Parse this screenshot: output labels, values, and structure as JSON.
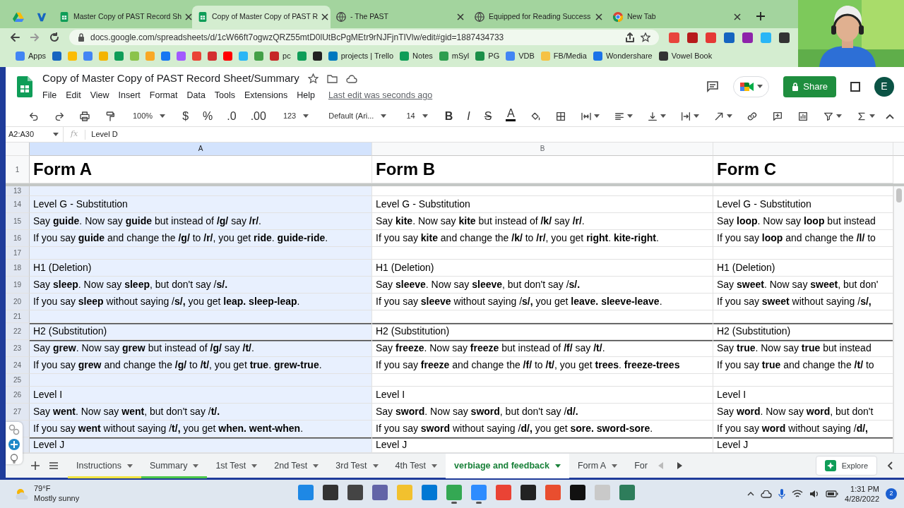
{
  "browser": {
    "tabs": [
      {
        "kind": "drive",
        "selected": false
      },
      {
        "kind": "vocab",
        "selected": false
      },
      {
        "kind": "sheets",
        "title": "Master Copy of PAST Record Sh",
        "selected": false
      },
      {
        "kind": "sheets",
        "title": "Copy of Master Copy of PAST R",
        "selected": true
      },
      {
        "kind": "globe",
        "title": "- The PAST",
        "selected": false
      },
      {
        "kind": "globe",
        "title": "Equipped for Reading Success",
        "selected": false
      },
      {
        "kind": "chrome",
        "title": "New Tab",
        "selected": false
      }
    ],
    "url": "docs.google.com/spreadsheets/d/1cW66ft7ogwzQRZ55mtD0lUtBcPgMEtr9rNJFjnTIVlw/edit#gid=1887434733",
    "extensions": [
      {
        "color": "#e8453c"
      },
      {
        "color": "#b71c1c"
      },
      {
        "color": "#e53935"
      },
      {
        "color": "#1565c0"
      },
      {
        "color": "#8e24aa"
      },
      {
        "color": "#29b6f6"
      },
      {
        "color": "#333333"
      }
    ],
    "bookmarks": [
      {
        "color": "#4285f4",
        "label": "Apps"
      },
      {
        "color": "#1565c0"
      },
      {
        "color": "#fbbc04"
      },
      {
        "color": "#4285f4"
      },
      {
        "color": "#f4b400"
      },
      {
        "color": "#0f9d58"
      },
      {
        "color": "#8bc34a"
      },
      {
        "color": "#f9a825"
      },
      {
        "color": "#1877f2"
      },
      {
        "color": "#a259ff"
      },
      {
        "color": "#ea4335"
      },
      {
        "color": "#d32f2f"
      },
      {
        "color": "#ff0000"
      },
      {
        "color": "#29b6f6"
      },
      {
        "color": "#43a047"
      },
      {
        "color": "#c62828",
        "label": "pc"
      },
      {
        "color": "#0f9d58"
      },
      {
        "color": "#222222"
      },
      {
        "color": "#0079bf",
        "label": "projects | Trello"
      },
      {
        "color": "#0f9d58",
        "label": "Notes"
      },
      {
        "color": "#2e9d4f",
        "label": "mSyl"
      },
      {
        "color": "#1b8f48",
        "label": "PG"
      },
      {
        "color": "#4285f4",
        "label": "VDB"
      },
      {
        "color": "#f6c244",
        "label": "FB/Media"
      },
      {
        "color": "#1a73e8",
        "label": "Wondershare"
      },
      {
        "color": "#333333",
        "label": "Vowel Book"
      }
    ]
  },
  "doc": {
    "title": "Copy of Master Copy of PAST Record Sheet/Summary",
    "menu": [
      "File",
      "Edit",
      "View",
      "Insert",
      "Format",
      "Data",
      "Tools",
      "Extensions",
      "Help"
    ],
    "last_edit": "Last edit was seconds ago",
    "share": "Share",
    "avatar": "E"
  },
  "toolbar": [
    {
      "kind": "undo"
    },
    {
      "kind": "redo"
    },
    {
      "kind": "print"
    },
    {
      "kind": "paint"
    },
    {
      "kind": "menu",
      "label": "100%"
    },
    {
      "kind": "text",
      "label": "$"
    },
    {
      "kind": "text",
      "label": "%"
    },
    {
      "kind": "text",
      "label": ".0"
    },
    {
      "kind": "text",
      "label": ".00"
    },
    {
      "kind": "menu",
      "label": "123"
    },
    {
      "kind": "menu",
      "label": "Default (Ari..."
    },
    {
      "kind": "menu",
      "label": "14"
    },
    {
      "kind": "bold",
      "label": "B"
    },
    {
      "kind": "italic",
      "label": "I"
    },
    {
      "kind": "strike",
      "label": "S"
    },
    {
      "kind": "color",
      "label": "A"
    },
    {
      "kind": "fill"
    },
    {
      "kind": "borders"
    },
    {
      "kind": "merge",
      "dropdown": true
    },
    {
      "kind": "align",
      "dropdown": true
    },
    {
      "kind": "valign",
      "dropdown": true
    },
    {
      "kind": "wrap",
      "dropdown": true
    },
    {
      "kind": "rotate",
      "dropdown": true
    },
    {
      "kind": "link"
    },
    {
      "kind": "comment"
    },
    {
      "kind": "chart"
    },
    {
      "kind": "filter",
      "dropdown": true
    },
    {
      "kind": "sigma",
      "dropdown": true
    }
  ],
  "sheet": {
    "name_box": "A2:A30",
    "fx": "fx",
    "formula": "Level D",
    "columns": [
      {
        "header": "A",
        "selected": true
      },
      {
        "header": "B",
        "selected": false
      },
      {
        "selected": false
      }
    ],
    "frozen_row": {
      "number": "1",
      "selected": false,
      "cells": [
        "Form A",
        "Form B",
        "Form C"
      ]
    },
    "rows": [
      {
        "number": "13",
        "selected": true,
        "ruled": false
      },
      {
        "number": "14",
        "selected": true,
        "ruled": false,
        "cells": [
          "Level G - Substitution",
          "Level G - Substitution",
          "Level G - Substitution"
        ]
      },
      {
        "number": "15",
        "selected": true,
        "ruled": false,
        "cells": [
          "Say **guide**. Now say **guide** but instead of **/g/** say **/r/**.",
          "Say **kite**. Now say **kite** but instead of **/k/** say **/r/**.",
          "Say **loop**. Now say **loop** but instead"
        ]
      },
      {
        "number": "16",
        "selected": true,
        "ruled": false,
        "cells": [
          "If you say **guide** and change the **/g/** to **/r/**, you get **ride**.  **guide-ride**.",
          "If you say **kite** and change the **/k/** to **/r/**, you get **right**.  **kite-right**.",
          "If you say **loop** and change the **/l/** to"
        ]
      },
      {
        "number": "17",
        "selected": true,
        "ruled": false
      },
      {
        "number": "18",
        "selected": true,
        "ruled": false,
        "cells": [
          "H1 (Deletion)",
          "H1 (Deletion)",
          "H1 (Deletion)"
        ]
      },
      {
        "number": "19",
        "selected": true,
        "ruled": false,
        "cells": [
          "Say **sleep**. Now say **sleep**, but don't say /**s/.**",
          "Say **sleeve**. Now say **sleeve**, but don't say /**s/.**",
          "Say **sweet**. Now say **sweet**, but don'"
        ]
      },
      {
        "number": "20",
        "selected": true,
        "ruled": false,
        "cells": [
          "If you say **sleep** without saying /**s/,** you get **leap. sleep-leap**.",
          "If you say **sleeve** without saying /**s/,** you get **leave. sleeve-leave**.",
          "If you say **sweet** without saying /**s/,**"
        ]
      },
      {
        "number": "21",
        "selected": true,
        "ruled": false
      },
      {
        "number": "22",
        "selected": true,
        "ruled": true,
        "cells": [
          "H2 (Substitution)",
          "H2 (Substitution)",
          "H2 (Substitution)"
        ]
      },
      {
        "number": "23",
        "selected": true,
        "ruled": true,
        "cells": [
          "Say **grew**. Now say **grew** but instead of **/g/** say **/t/**.",
          "Say **freeze**. Now say **freeze** but instead of **/f/** say **/t/**.",
          "Say **true**. Now say **true** but instead"
        ]
      },
      {
        "number": "24",
        "selected": true,
        "ruled": false,
        "cells": [
          "If you say **grew** and change the **/g/** to **/t/**, you get **true**.  **grew-true**.",
          "If you say **freeze** and change the **/f/** to **/t/**, you get **trees**.  **freeze-trees**",
          "If you say **true** and change the **/t/** to"
        ]
      },
      {
        "number": "25",
        "selected": true,
        "ruled": false
      },
      {
        "number": "26",
        "selected": true,
        "ruled": false,
        "cells": [
          "Level I",
          "Level I",
          "Level I"
        ]
      },
      {
        "number": "27",
        "selected": true,
        "ruled": false,
        "cells": [
          "Say **went**. Now say **went**, but don't say /**t/.**",
          "Say **sword**. Now say **sword**, but don't say /**d/.**",
          "Say **word**. Now say **word**, but don't"
        ]
      },
      {
        "selected": true,
        "ruled": false,
        "cells": [
          "If you say **went** without saying /**t/,** you get **when. went-when**.",
          "If you say **sword** without saying /**d/,** you get **sore. sword-sore**.",
          "If you say **word** without saying /**d/,**"
        ]
      },
      {
        "selected": true,
        "ruled": true,
        "cells": [
          "Level J",
          "Level J",
          "Level J"
        ]
      }
    ]
  },
  "sheet_tabs": [
    {
      "label": "Instructions",
      "color": "#f2e440",
      "selected": false
    },
    {
      "label": "Summary",
      "color": "#4cc84a",
      "selected": false
    },
    {
      "label": "1st Test",
      "selected": false
    },
    {
      "label": "2nd Test",
      "selected": false
    },
    {
      "label": "3rd Test",
      "selected": false
    },
    {
      "label": "4th Test",
      "selected": false
    },
    {
      "label": "verbiage and feedback",
      "selected": true
    },
    {
      "label": "Form A",
      "selected": false
    },
    {
      "label": "For",
      "selected": false
    }
  ],
  "explore": "Explore",
  "taskbar": {
    "temperature": "79°F",
    "weather": "Mostly sunny",
    "apps": [
      {
        "color": "#1e88e5",
        "active": false
      },
      {
        "color": "#333333",
        "active": false
      },
      {
        "color": "#444444",
        "active": false
      },
      {
        "color": "#6264a7",
        "active": false
      },
      {
        "color": "#f2c12e",
        "active": false
      },
      {
        "color": "#0078d4",
        "active": false
      },
      {
        "color": "#34a853",
        "active": true
      },
      {
        "color": "#2d8cff",
        "active": true
      },
      {
        "color": "#ea4335",
        "active": false
      },
      {
        "color": "#222222",
        "active": false
      },
      {
        "color": "#e94e2f",
        "active": false
      },
      {
        "color": "#111111",
        "active": false
      },
      {
        "color": "#c9c9c9",
        "active": false
      },
      {
        "color": "#2e7d5b",
        "active": false
      }
    ],
    "time": "1:31 PM",
    "date": "4/28/2022",
    "notifications": "2"
  }
}
